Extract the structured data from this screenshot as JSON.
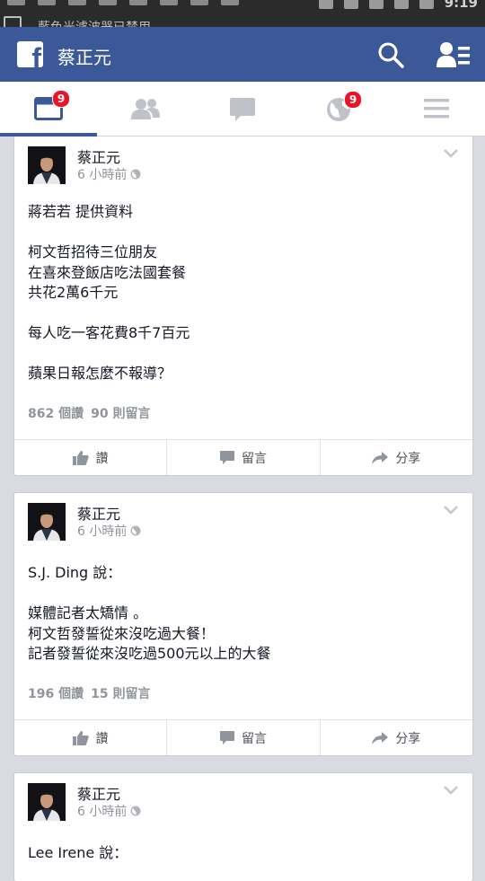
{
  "status_bar": {
    "notification_text": "藍色光濾波器已禁用",
    "time": "9:19"
  },
  "header": {
    "logo_letter": "f",
    "title": "蔡正元",
    "search_icon": "search-icon",
    "friends_icon": "friend-requests-icon"
  },
  "tabs": [
    {
      "name": "news-feed",
      "icon": "newsfeed-icon",
      "badge": "9",
      "active": true
    },
    {
      "name": "friend-requests",
      "icon": "friends-icon",
      "badge": "",
      "active": false
    },
    {
      "name": "messages",
      "icon": "chat-bubble-icon",
      "badge": "",
      "active": false
    },
    {
      "name": "notifications",
      "icon": "globe-icon",
      "badge": "9",
      "active": false
    },
    {
      "name": "more",
      "icon": "menu-icon",
      "badge": "",
      "active": false
    }
  ],
  "posts": [
    {
      "author": "蔡正元",
      "time": "6 小時前",
      "lines": [
        "蔣若若 提供資料",
        "",
        "柯文哲招待三位朋友",
        "在喜來登飯店吃法國套餐",
        "共花2萬6千元",
        "",
        "每人吃一客花費8千7百元",
        "",
        "蘋果日報怎麼不報導？"
      ],
      "views": "862 個讚",
      "comments": "90 則留言",
      "like_label": "讚",
      "comment_label": "留言",
      "share_label": "分享"
    },
    {
      "author": "蔡正元",
      "time": "6 小時前",
      "lines": [
        "S.J. Ding 說：",
        "",
        "媒體記者太矯情 。",
        "柯文哲發誓從來沒吃過大餐！",
        "記者發誓從來沒吃過500元以上的大餐"
      ],
      "views": "196 個讚",
      "comments": "15 則留言",
      "like_label": "讚",
      "comment_label": "留言",
      "share_label": "分享"
    },
    {
      "author": "蔡正元",
      "time": "6 小時前",
      "lines": [
        "Lee Irene  說："
      ]
    }
  ],
  "colors": {
    "facebook_blue": "#3b5998",
    "badge_red": "#e9142a",
    "feed_background": "#d9dbe0"
  }
}
